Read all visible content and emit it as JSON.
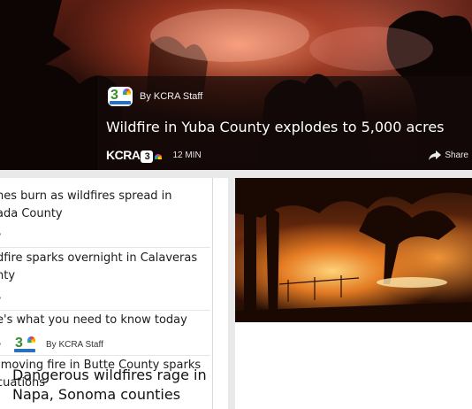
{
  "hero": {
    "byline": "By KCRA Staff",
    "title": "Wildfire in Yuba County explodes to 5,000 acres",
    "brand": "KCRA",
    "brand_channel": "3",
    "time": "12 MIN",
    "share_label": "Share"
  },
  "list": {
    "items": [
      {
        "line1": "nes burn as wildfires spread in",
        "line2": "ada County"
      },
      {
        "line1": "dfire sparks overnight in Calaveras",
        "line2": "nty"
      },
      {
        "line1": "e's what you need to know today",
        "line2": ""
      },
      {
        "line1": "-moving fire in Butte County sparks",
        "line2": "cuations"
      }
    ]
  },
  "card": {
    "byline": "By KCRA Staff",
    "title_line1": "Dangerous wildfires rage in",
    "title_line2": "Napa, Sonoma counties"
  },
  "logo": {
    "channel": "3",
    "icon": "kcra3-logo-icon"
  },
  "colors": {
    "fire_orange": "#ff8a3a",
    "logo_green": "#3b8c2e",
    "logo_blue": "#2b6fbf",
    "text_dark": "#1c1c1c"
  }
}
